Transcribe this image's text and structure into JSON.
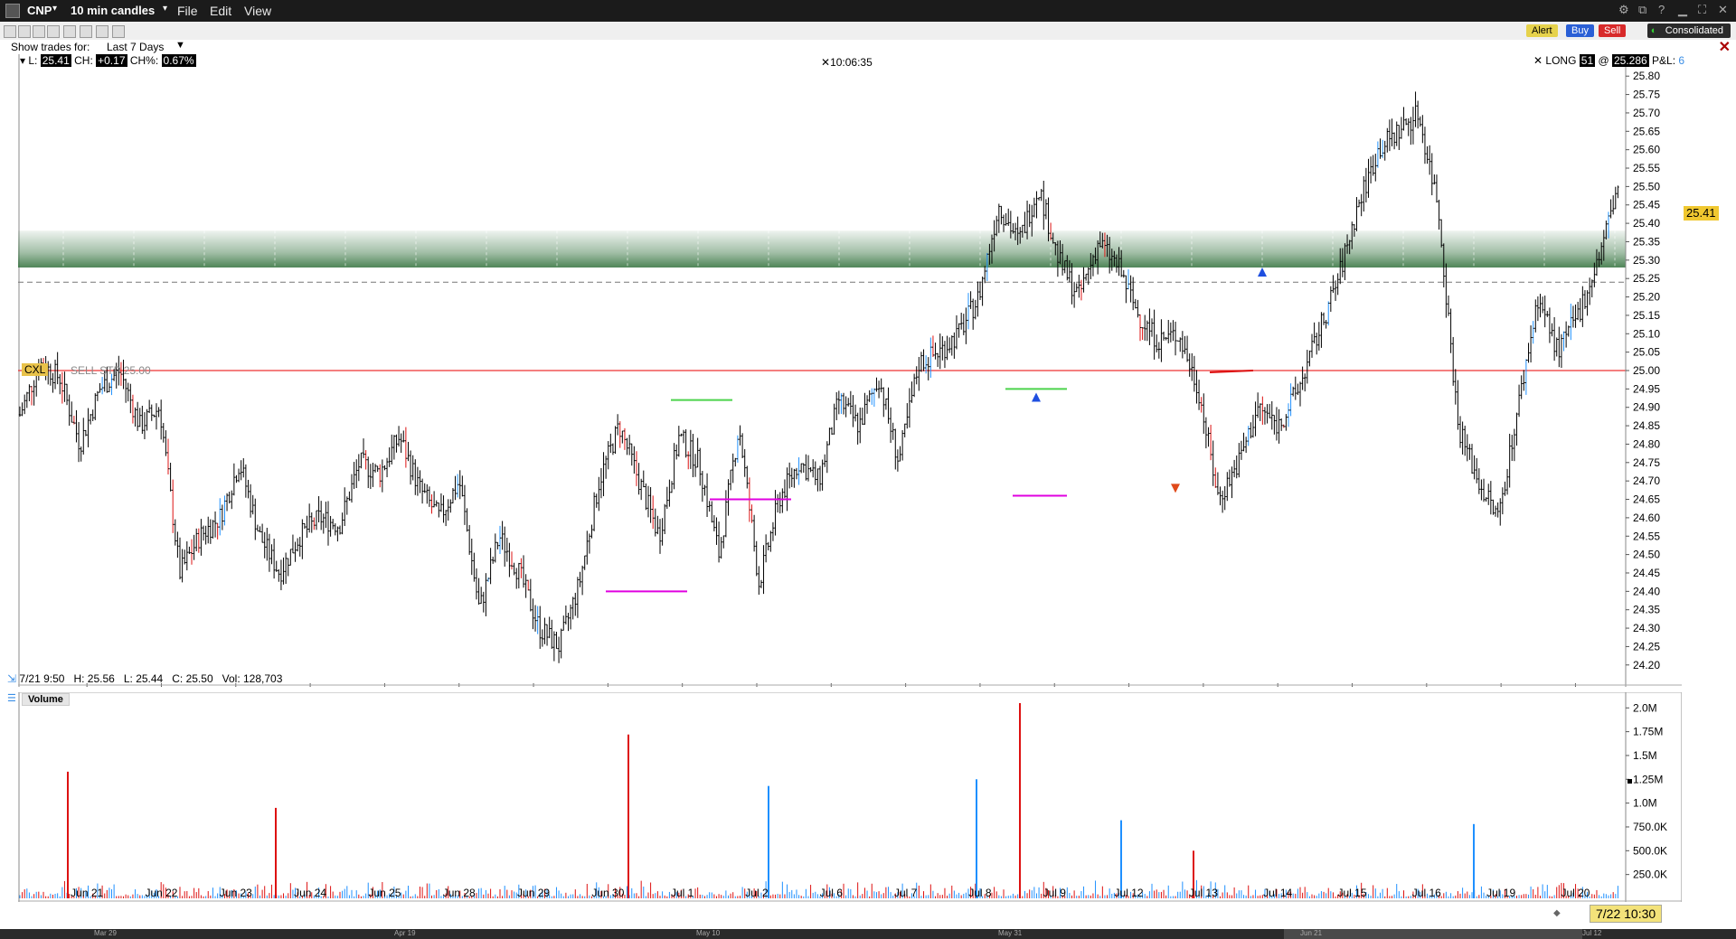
{
  "window": {
    "symbol": "CNP",
    "interval": "10 min candles",
    "menu": [
      "File",
      "Edit",
      "View"
    ]
  },
  "toolbar": {
    "alert": "Alert",
    "buy": "Buy",
    "sell": "Sell",
    "consolidated": "Consolidated",
    "show_trades_label": "Show trades for:",
    "show_trades_value": "Last 7 Days"
  },
  "header": {
    "last_label": "L:",
    "last_value": "25.41",
    "change_label": "CH:",
    "change_value": "+0.17",
    "change_pct_label": "CH%:",
    "change_pct_value": "0.67%",
    "time": "10:06:35",
    "position_side": "LONG",
    "position_qty": "51",
    "position_at": "@",
    "position_price": "25.286",
    "pnl_label": "P&L:",
    "pnl_value": "6"
  },
  "order_line": {
    "cancel_label": "CXL",
    "order_text": "SELL STP 25.00"
  },
  "price_tag": "25.41",
  "crosshair_info": {
    "date": "7/21 9:50",
    "high": "H: 25.56",
    "low": "L: 25.44",
    "close": "C: 25.50",
    "volume": "Vol: 128,703"
  },
  "volume_panel": {
    "title": "Volume"
  },
  "selected_date": "7/22 10:30",
  "overview_labels": [
    "Mar 29",
    "Apr 19",
    "May 10",
    "May 31",
    "Jun 21",
    "Jul 12"
  ],
  "colors": {
    "up": "#1e90ff",
    "down": "#d11",
    "bar": "#000",
    "zone": "#2f6f3a",
    "order_line": "#e33"
  },
  "chart_data": [
    {
      "type": "candlestick",
      "title": "CNP 10 min candles",
      "x_labels": [
        "Jun 21",
        "Jun 22",
        "Jun 23",
        "Jun 24",
        "Jun 25",
        "Jun 28",
        "Jun 29",
        "Jun 30",
        "Jul 1",
        "Jul 2",
        "Jul 6",
        "Jul 7",
        "Jul 8",
        "Jul 9",
        "Jul 12",
        "Jul 13",
        "Jul 14",
        "Jul 15",
        "Jul 16",
        "Jul 19",
        "Jul 20"
      ],
      "y_ticks": [
        "25.80",
        "25.75",
        "25.70",
        "25.65",
        "25.60",
        "25.55",
        "25.50",
        "25.45",
        "25.40",
        "25.35",
        "25.30",
        "25.25",
        "25.20",
        "25.15",
        "25.10",
        "25.05",
        "25.00",
        "24.95",
        "24.90",
        "24.85",
        "24.80",
        "24.75",
        "24.70",
        "24.65",
        "24.60",
        "24.55",
        "24.50",
        "24.45",
        "24.40",
        "24.35",
        "24.30",
        "24.25",
        "24.20"
      ],
      "ylim": [
        24.17,
        25.83
      ],
      "path_closes": [
        24.88,
        25.02,
        24.98,
        24.8,
        24.95,
        25.0,
        24.85,
        24.9,
        24.45,
        24.55,
        24.6,
        24.75,
        24.55,
        24.45,
        24.55,
        24.6,
        24.58,
        24.75,
        24.72,
        24.82,
        24.68,
        24.6,
        24.7,
        24.35,
        24.55,
        24.45,
        24.3,
        24.25,
        24.42,
        24.7,
        24.85,
        24.7,
        24.55,
        24.82,
        24.75,
        24.5,
        24.85,
        24.42,
        24.65,
        24.75,
        24.7,
        24.92,
        24.85,
        24.98,
        24.75,
        25.02,
        25.05,
        25.1,
        25.2,
        25.45,
        25.35,
        25.5,
        25.3,
        25.2,
        25.35,
        25.28,
        25.15,
        25.08,
        25.1,
        24.95,
        24.65,
        24.75,
        24.9,
        24.85,
        24.95,
        25.1,
        25.25,
        25.45,
        25.6,
        25.65,
        25.7,
        25.45,
        24.85,
        24.7,
        24.6,
        24.9,
        25.2,
        25.05,
        25.15,
        25.3,
        25.5
      ],
      "zone": [
        25.28,
        25.38
      ],
      "dashed_line": 25.24,
      "order_line": 25.0,
      "last_price": 25.41,
      "grid": false,
      "annotations": {
        "magenta_lines": [
          [
            24.4
          ],
          [
            24.65
          ],
          [
            24.66
          ]
        ],
        "green_lines": [
          [
            24.92
          ],
          [
            24.95
          ]
        ],
        "red_line": [
          25.0
        ],
        "buy_markers": [
          24.93,
          25.27
        ],
        "sell_markers": [
          24.68
        ]
      }
    },
    {
      "type": "bar",
      "title": "Volume",
      "y_ticks": [
        "2.0M",
        "1.75M",
        "1.5M",
        "1.25M",
        "1.0M",
        "750.0K",
        "500.0K",
        "250.0K"
      ],
      "ylim": [
        0,
        2050000
      ],
      "spikes": [
        {
          "session": "Jun 21",
          "value": 1330000,
          "color": "red"
        },
        {
          "session": "Jun 23",
          "value": 950000,
          "color": "red"
        },
        {
          "session": "Jun 30",
          "value": 1720000,
          "color": "red"
        },
        {
          "session": "Jul 6",
          "value": 1180000,
          "color": "blue"
        },
        {
          "session": "Jul 9",
          "value": 1250000,
          "color": "blue"
        },
        {
          "session": "Jul 9",
          "value": 2050000,
          "color": "red"
        },
        {
          "session": "Jul 12",
          "value": 820000,
          "color": "blue"
        },
        {
          "session": "Jul 14",
          "value": 500000,
          "color": "red"
        },
        {
          "session": "Jul 19",
          "value": 780000,
          "color": "blue"
        }
      ]
    }
  ]
}
